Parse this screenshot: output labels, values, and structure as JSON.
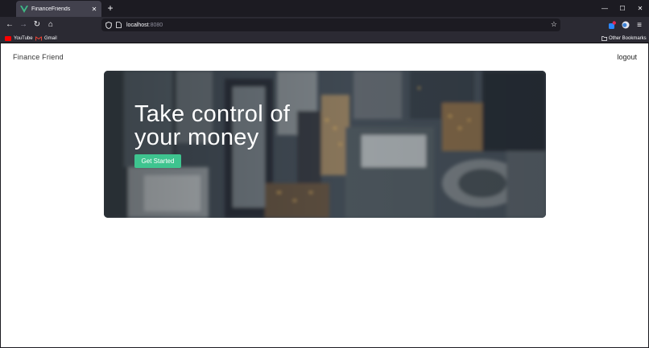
{
  "browser": {
    "tab": {
      "title": "FinanceFriends",
      "icon": "vue-logo-icon"
    },
    "new_tab_label": "+",
    "window_controls": {
      "minimize": "—",
      "maximize": "☐",
      "close": "✕"
    },
    "nav": {
      "back": "←",
      "forward": "→",
      "reload": "↻",
      "home": "⌂"
    },
    "url": {
      "host": "localhost",
      "port": ":8080"
    },
    "bookmarks": [
      {
        "label": "YouTube",
        "icon": "youtube-icon"
      },
      {
        "label": "Gmail",
        "icon": "gmail-icon"
      }
    ],
    "other_bookmarks": "Other Bookmarks"
  },
  "page": {
    "brand": "Finance Friend",
    "logout": "logout",
    "hero": {
      "heading_line1": "Take control of",
      "heading_line2": "your money",
      "cta": "Get Started"
    }
  },
  "colors": {
    "accent": "#3ec48f",
    "chrome_dark": "#1c1b22",
    "chrome_toolbar": "#2b2a33",
    "tab_active": "#42414d"
  }
}
